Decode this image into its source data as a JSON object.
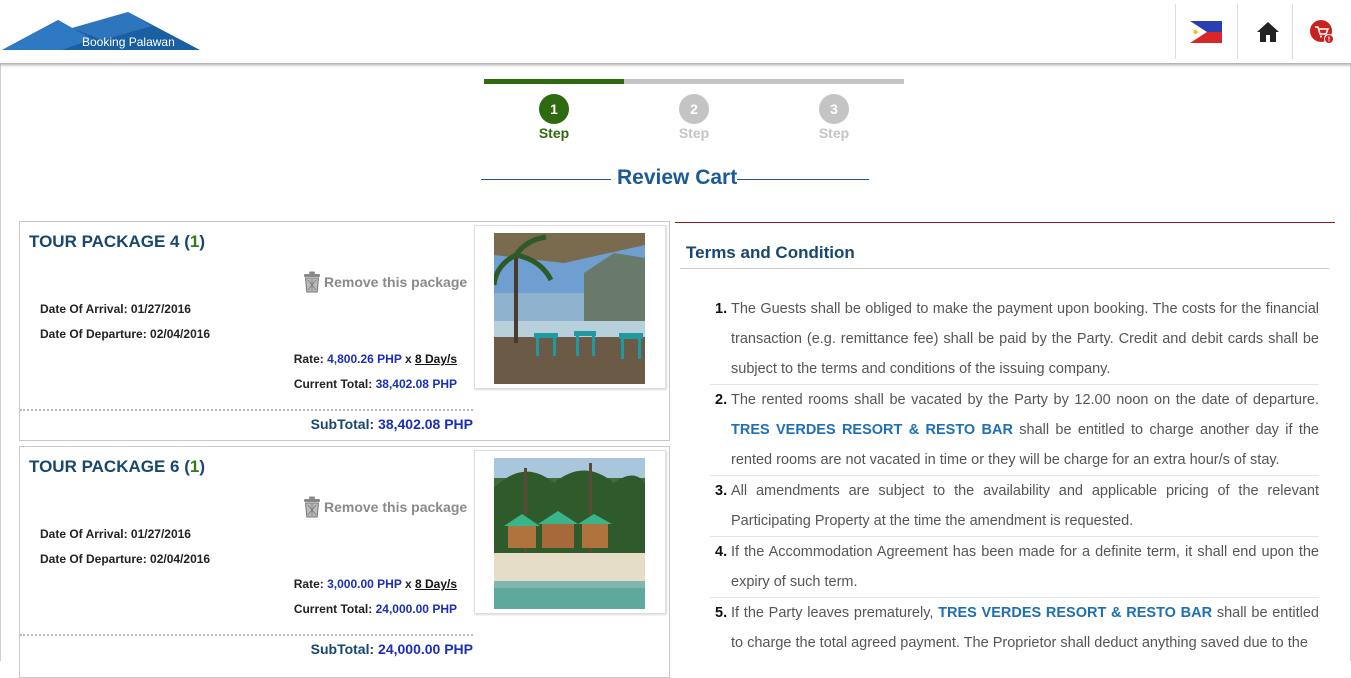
{
  "header": {
    "logo_text_1": "Booking",
    "logo_text_2": "Palawan",
    "flag_icon": "philippines-flag-icon",
    "home_icon": "home-icon",
    "cart_icon": "cart-icon"
  },
  "stepper": {
    "steps": [
      {
        "number": "1",
        "label": "Step",
        "active": true
      },
      {
        "number": "2",
        "label": "Step",
        "active": false
      },
      {
        "number": "3",
        "label": "Step",
        "active": false
      }
    ],
    "progress_fraction": 0.333
  },
  "page": {
    "title": "Review Cart"
  },
  "packages": [
    {
      "name": "TOUR PACKAGE 4",
      "qty_open": " (",
      "qty": "1",
      "qty_close": ")",
      "remove_label": "Remove this package",
      "arrival_label": "Date Of Arrival: ",
      "arrival": "01/27/2016",
      "departure_label": "Date Of Departure: ",
      "departure": "02/04/2016",
      "rate_label": "Rate: ",
      "rate": "4,800.26 PHP",
      "times": " x ",
      "days": "8 Day/s",
      "current_total_label": "Current Total: ",
      "current_total": "38,402.08 PHP",
      "subtotal_label": "SubTotal: ",
      "subtotal": "38,402.08 PHP"
    },
    {
      "name": "TOUR PACKAGE 6",
      "qty_open": " (",
      "qty": "1",
      "qty_close": ")",
      "remove_label": "Remove this package",
      "arrival_label": "Date Of Arrival: ",
      "arrival": "01/27/2016",
      "departure_label": "Date Of Departure: ",
      "departure": "02/04/2016",
      "rate_label": "Rate: ",
      "rate": "3,000.00 PHP",
      "times": " x ",
      "days": "8 Day/s",
      "current_total_label": "Current Total: ",
      "current_total": "24,000.00 PHP",
      "subtotal_label": "SubTotal: ",
      "subtotal": "24,000.00 PHP"
    }
  ],
  "terms": {
    "title": "Terms and Condition",
    "items": [
      {
        "num": "1.",
        "text": "The Guests shall be obliged to make the payment upon booking. The costs for the financial transaction (e.g. remittance fee) shall be paid by the Party. Credit and debit cards shall be subject to the terms and conditions of the issuing company."
      },
      {
        "num": "2.",
        "pre": "The rented rooms shall be vacated by the Party by 12.00 noon on the date of departure. ",
        "highlight": "TRES VERDES RESORT & RESTO BAR",
        "post": " shall be entitled to charge another day if the rented rooms are not vacated in time or they will be charge for an extra hour/s of stay."
      },
      {
        "num": "3.",
        "text": "All amendments are subject to the availability and applicable pricing of the relevant Participating Property at the time the amendment is requested."
      },
      {
        "num": "4.",
        "text": "If the Accommodation Agreement has been made for a definite term, it shall end upon the expiry of such term."
      },
      {
        "num": "5.",
        "pre": "If the Party leaves prematurely, ",
        "highlight": "TRES VERDES RESORT & RESTO BAR",
        "post": " shall be entitled to charge the total agreed payment. The Proprietor shall deduct anything saved due to the"
      }
    ]
  },
  "colors": {
    "brand_blue": "#1b5a96",
    "step_active": "#2e6a0f",
    "step_inactive": "#c4c4c4",
    "price_blue": "#1a2fb8"
  }
}
